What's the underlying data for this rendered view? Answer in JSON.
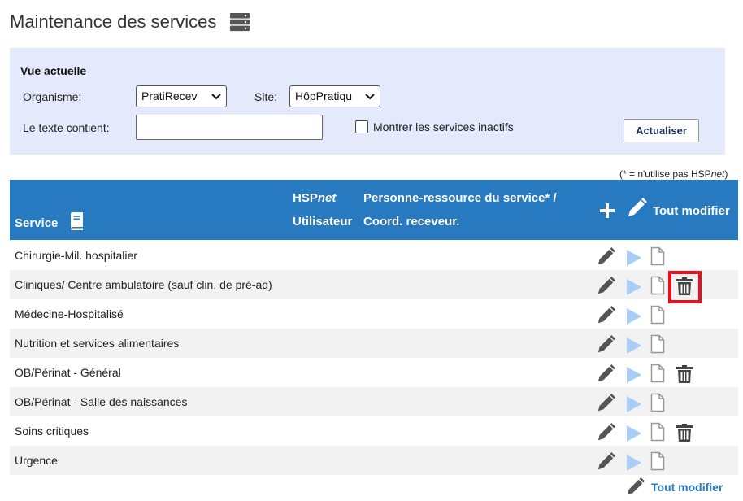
{
  "page": {
    "title": "Maintenance des services",
    "title_icon": "server-stack-icon"
  },
  "filters": {
    "heading": "Vue actuelle",
    "organism_label": "Organisme:",
    "organism_value": "PratiRecev",
    "site_label": "Site:",
    "site_value": "HôpPratiqu",
    "text_label": "Le texte contient:",
    "text_value": "",
    "show_inactive_label": "Montrer les services inactifs",
    "show_inactive_checked": false,
    "refresh_label": "Actualiser"
  },
  "note": {
    "prefix": "(* = n'utilise pas HSP",
    "italic": "net",
    "suffix": ")"
  },
  "table": {
    "header": {
      "service": "Service",
      "hsp_bold": "HSP",
      "hsp_italic": "net",
      "user": "Utilisateur",
      "contact_line1": "Personne-ressource du service* /",
      "contact_line2": "Coord. receveur.",
      "edit_all": "Tout modifier"
    },
    "rows": [
      {
        "name": "Chirurgie-Mil. hospitalier",
        "has_delete": false
      },
      {
        "name": "Cliniques/ Centre ambulatoire (sauf clin. de pré-ad)",
        "has_delete": true,
        "highlighted": true
      },
      {
        "name": "Médecine-Hospitalisé",
        "has_delete": false
      },
      {
        "name": "Nutrition et services alimentaires",
        "has_delete": false
      },
      {
        "name": "OB/Périnat - Général",
        "has_delete": true
      },
      {
        "name": "OB/Périnat - Salle des naissances",
        "has_delete": false
      },
      {
        "name": "Soins critiques",
        "has_delete": true
      },
      {
        "name": "Urgence",
        "has_delete": false
      }
    ],
    "footer_edit_all": "Tout modifier"
  },
  "colors": {
    "header_blue": "#2779c0",
    "panel_bg": "#e4e9fb",
    "play_blue": "#a9cdf7",
    "highlight_red": "#e8101b"
  }
}
